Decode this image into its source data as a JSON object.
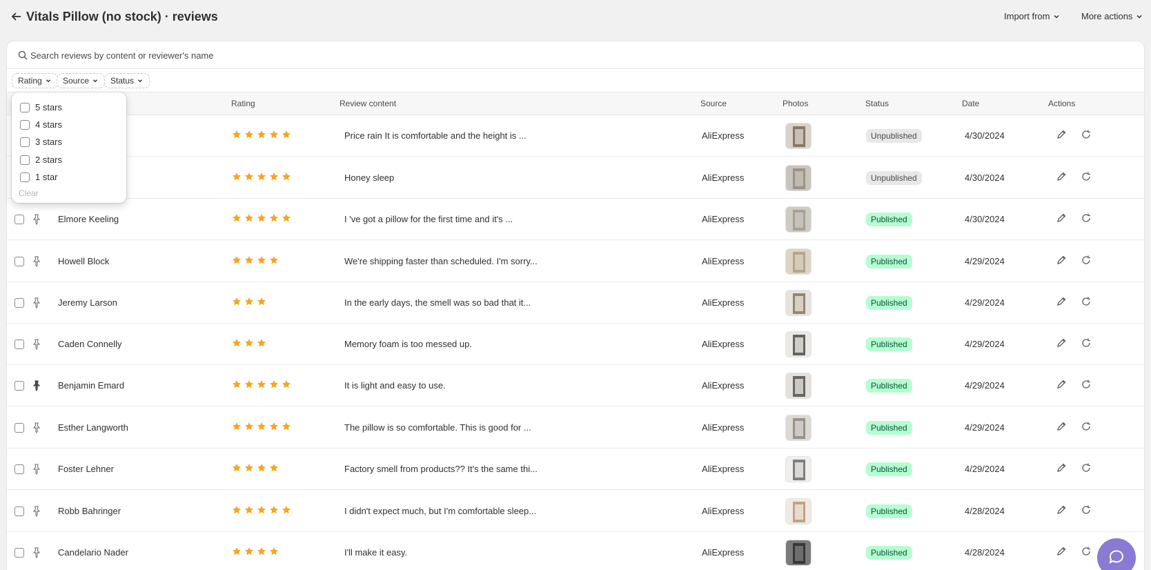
{
  "header": {
    "title": "Vitals Pillow (no stock) · reviews",
    "import_label": "Import from",
    "more_actions_label": "More actions"
  },
  "search": {
    "placeholder": "Search reviews by content or reviewer's name"
  },
  "filters": {
    "rating": "Rating",
    "source": "Source",
    "status": "Status"
  },
  "rating_dropdown": {
    "options": [
      "5 stars",
      "4 stars",
      "3 stars",
      "2 stars",
      "1 star"
    ],
    "clear": "Clear"
  },
  "table": {
    "columns": {
      "rating": "Rating",
      "content": "Review content",
      "source": "Source",
      "photos": "Photos",
      "status": "Status",
      "date": "Date",
      "actions": "Actions"
    },
    "rows": [
      {
        "name": "",
        "rating": 5,
        "content": "Price rain It is comfortable and the height is ...",
        "source": "AliExpress",
        "status": "Unpublished",
        "date": "4/30/2024",
        "pinned": false
      },
      {
        "name": "",
        "rating": 5,
        "content": "Honey sleep",
        "source": "AliExpress",
        "status": "Unpublished",
        "date": "4/30/2024",
        "pinned": false
      },
      {
        "name": "Elmore Keeling",
        "rating": 5,
        "content": "I 've got a pillow for the first time and it's ...",
        "source": "AliExpress",
        "status": "Published",
        "date": "4/30/2024",
        "pinned": false
      },
      {
        "name": "Howell Block",
        "rating": 4,
        "content": "We're shipping faster than scheduled. I'm sorry...",
        "source": "AliExpress",
        "status": "Published",
        "date": "4/29/2024",
        "pinned": false
      },
      {
        "name": "Jeremy Larson",
        "rating": 3,
        "content": "In the early days, the smell was so bad that it...",
        "source": "AliExpress",
        "status": "Published",
        "date": "4/29/2024",
        "pinned": false
      },
      {
        "name": "Caden Connelly",
        "rating": 3,
        "content": "Memory foam is too messed up.",
        "source": "AliExpress",
        "status": "Published",
        "date": "4/29/2024",
        "pinned": false
      },
      {
        "name": "Benjamin Emard",
        "rating": 5,
        "content": "It is light and easy to use.",
        "source": "AliExpress",
        "status": "Published",
        "date": "4/29/2024",
        "pinned": true
      },
      {
        "name": "Esther Langworth",
        "rating": 5,
        "content": "The pillow is so comfortable. This is good for ...",
        "source": "AliExpress",
        "status": "Published",
        "date": "4/29/2024",
        "pinned": false
      },
      {
        "name": "Foster Lehner",
        "rating": 4,
        "content": "Factory smell from products?? It's the same thi...",
        "source": "AliExpress",
        "status": "Published",
        "date": "4/29/2024",
        "pinned": false
      },
      {
        "name": "Robb Bahringer",
        "rating": 5,
        "content": "I didn't expect much, but I'm comfortable sleep...",
        "source": "AliExpress",
        "status": "Published",
        "date": "4/28/2024",
        "pinned": false
      },
      {
        "name": "Candelario Nader",
        "rating": 4,
        "content": "I'll make it easy.",
        "source": "AliExpress",
        "status": "Published",
        "date": "4/28/2024",
        "pinned": false
      }
    ]
  },
  "colors": {
    "star": "#f5a623",
    "published_bg": "#b4fed2",
    "unpublished_bg": "#e8e8e8",
    "help_button": "#8b7ad3"
  }
}
